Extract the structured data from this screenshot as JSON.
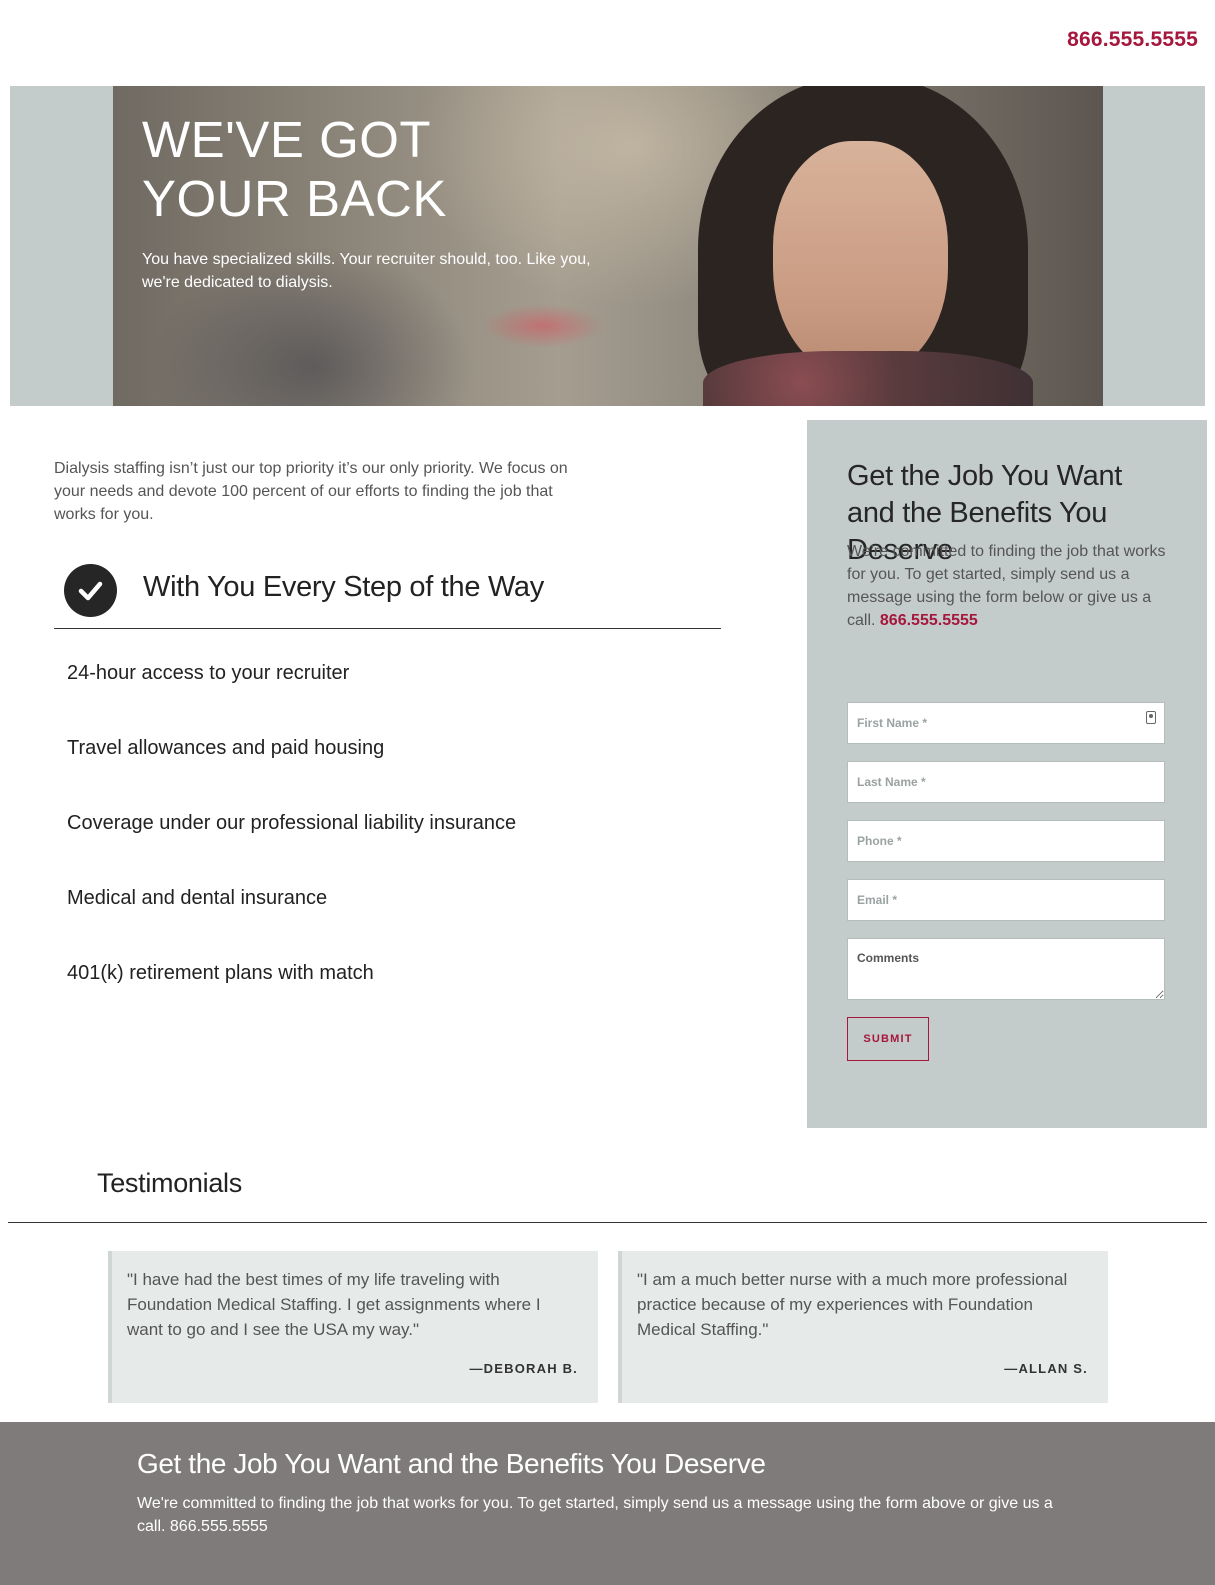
{
  "header": {
    "phone": "866.555.5555"
  },
  "hero": {
    "title_line1": "WE'VE GOT",
    "title_line2": "YOUR BACK",
    "subtitle": "You have specialized skills. Your recruiter should, too. Like you, we're dedicated to dialysis."
  },
  "intro": "Dialysis staffing isn’t just our top priority it’s our only priority. We focus on your needs and devote 100 percent of our efforts to finding the job that works for you.",
  "steps": {
    "title": "With You Every Step of the Way",
    "items": [
      "24-hour access to your recruiter",
      "Travel allowances and paid housing",
      "Coverage under our professional liability insurance",
      "Medical and dental insurance",
      "401(k) retirement plans with match"
    ]
  },
  "form": {
    "title": "Get the Job You Want and the Benefits You Deserve",
    "description": "We're committed to finding the job that works for you. To get started, simply send us a message using the form below or give us a call.",
    "phone": "866.555.5555",
    "first_name_placeholder": "First Name *",
    "last_name_placeholder": "Last Name *",
    "phone_placeholder": "Phone *",
    "email_placeholder": "Email *",
    "comments_placeholder": "Comments",
    "submit_label": "SUBMIT"
  },
  "testimonials": {
    "heading": "Testimonials",
    "items": [
      {
        "quote": "\"I have had the best times of my life traveling with Foundation Medical Staffing. I get assignments where I want to go and I see the USA my way.\"",
        "author": "—DEBORAH B."
      },
      {
        "quote": "\"I am a much better nurse with a much more professional practice because of my experiences with Foundation Medical Staffing.\"",
        "author": "—ALLAN S."
      }
    ]
  },
  "footer": {
    "title": "Get the Job You Want and the Benefits You Deserve",
    "description": "We're committed to finding the job that works for you. To get started, simply send us a message using the form above or give us a call. 866.555.5555"
  },
  "colors": {
    "accent": "#a5173c",
    "panel": "#c4cccb",
    "footer": "#7f7b7b",
    "card": "#e6eae9"
  },
  "icons": [
    "checkmark-icon",
    "contact-card-icon"
  ]
}
